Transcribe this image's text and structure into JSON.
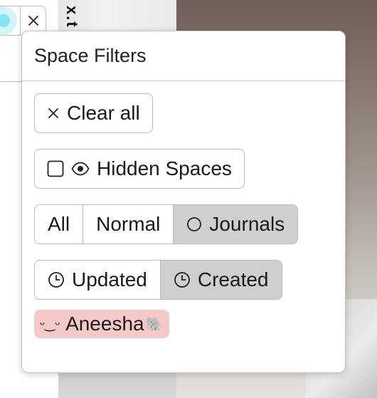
{
  "background": {
    "vertical_text_top": "x.t",
    "vertical_text_bottom": "x."
  },
  "top_widget": {
    "close_glyph": "×"
  },
  "panel": {
    "title": "Space Filters",
    "clear_all": {
      "icon": "close-icon",
      "glyph": "×",
      "label": "Clear all"
    },
    "hidden_spaces": {
      "checked": false,
      "icon": "eye-icon",
      "label": "Hidden Spaces"
    },
    "type_filter": [
      {
        "label": "All",
        "active": false
      },
      {
        "label": "Normal",
        "active": false
      },
      {
        "label": "Journals",
        "active": true,
        "icon": "circle-icon"
      }
    ],
    "sort_filter": [
      {
        "label": "Updated",
        "active": false,
        "icon": "clock-icon"
      },
      {
        "label": "Created",
        "active": true,
        "icon": "clock-icon"
      }
    ],
    "user_chip": {
      "face": "ᵕ‿ᵕ",
      "name": "Aneesha",
      "emoji": "🐘",
      "color": "#f6c9c9"
    }
  },
  "colors": {
    "active_segment": "#cfcfcf",
    "border": "#b9b9b9",
    "cyan_accent": "#86e4ee"
  }
}
